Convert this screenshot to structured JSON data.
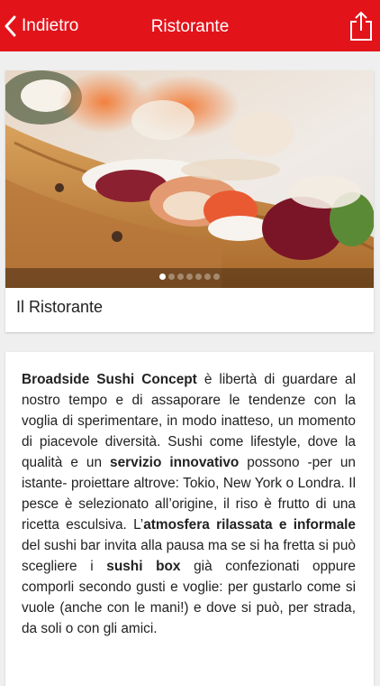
{
  "navbar": {
    "back_label": "Indietro",
    "title": "Ristorante",
    "background_color": "#e3131a",
    "share_icon": "share-icon",
    "back_icon": "chevron-left-icon"
  },
  "gallery": {
    "caption": "Il Ristorante",
    "image_subject": "sushi rolls served on a wooden boat",
    "page_count": 7,
    "current_page": 1
  },
  "description": {
    "segments": [
      {
        "text": "Broadside Sushi Concept",
        "bold": true
      },
      {
        "text": " è libertà di guardare al nostro tempo e di assaporare le tendenze con la voglia di sperimentare, in modo inatteso, un momento di piacevole diversità. Sushi come lifestyle, dove la qualità e un ",
        "bold": false
      },
      {
        "text": "servizio innovativo",
        "bold": true
      },
      {
        "text": " possono -per un istante- proiettare altrove: Tokio, New York o Londra. Il pesce è selezionato all’origine, il riso è frutto di una ricetta esculsiva. L’",
        "bold": false
      },
      {
        "text": "atmosfera rilassata e informale",
        "bold": true
      },
      {
        "text": " del sushi bar invita alla pausa ma se si ha fretta si può scegliere i ",
        "bold": false
      },
      {
        "text": "sushi box",
        "bold": true
      },
      {
        "text": " già confezionati oppure comporli secondo gusti e voglie: per gustarlo come si vuole (anche con le mani!) e dove si può, per strada, da soli o con gli amici.",
        "bold": false
      }
    ]
  }
}
